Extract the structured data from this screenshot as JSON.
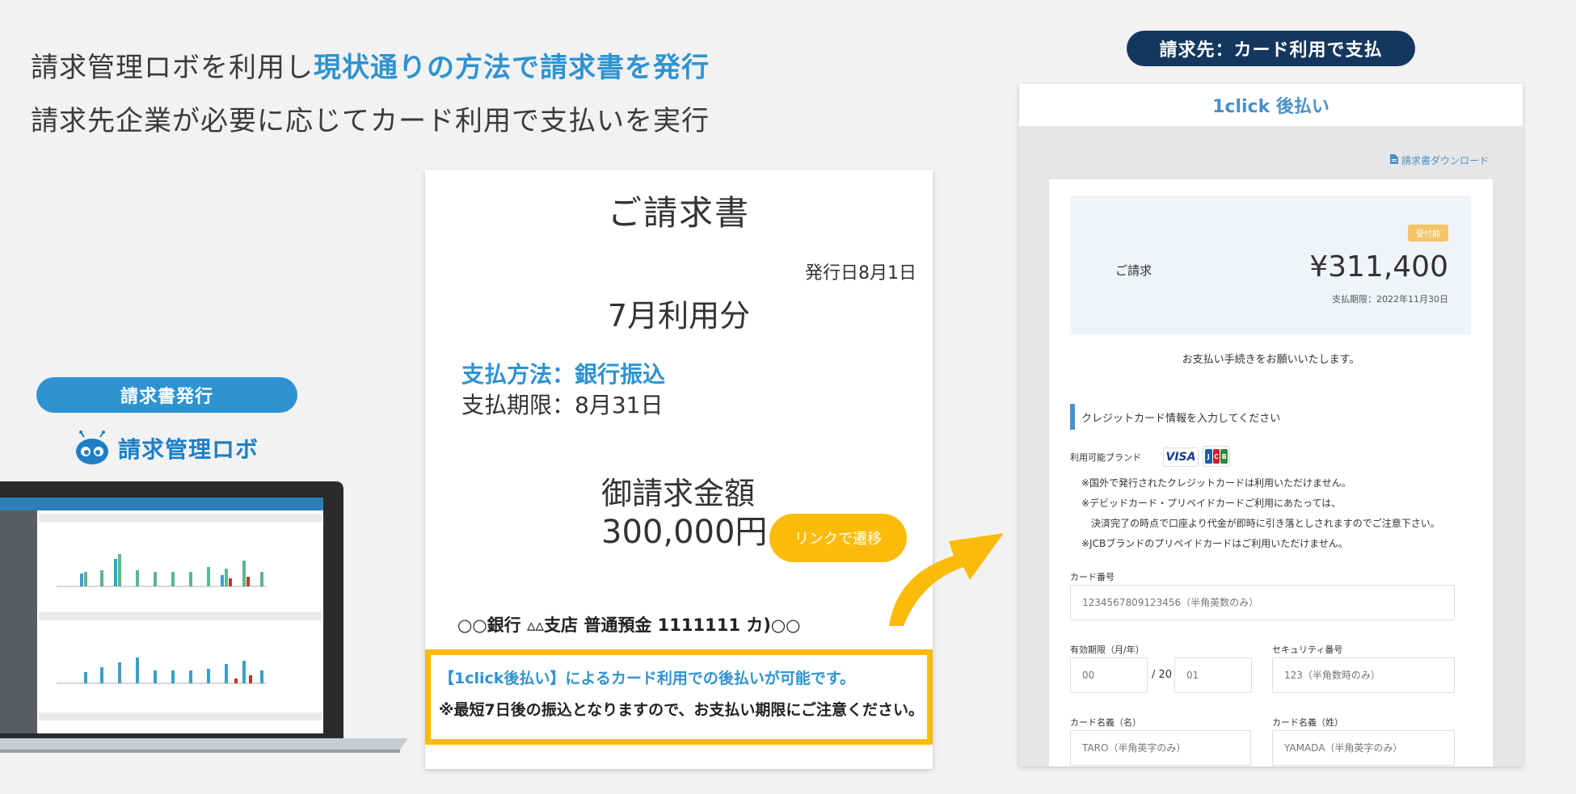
{
  "headline": {
    "line1_prefix": "請求管理ロボを利用し",
    "line1_highlight": "現状通りの方法で請求書を発行",
    "line2": "請求先企業が必要に応じてカード利用で支払いを実行"
  },
  "left": {
    "pill_label": "請求書発行",
    "logo_text": "請求管理ロボ"
  },
  "invoice": {
    "title": "ご請求書",
    "issue_date": "発行日8月1日",
    "usage_month": "7月利用分",
    "payment_method": "支払方法：銀行振込",
    "payment_due": "支払期限：8月31日",
    "amount_label": "御請求金額",
    "amount": "300,000円",
    "link_button": "リンクで遷移",
    "bank_info": "○○銀行 ▵▵支店 普通預金 1111111 カ)○○",
    "notice_line1": "【1click後払い】によるカード利用での後払いが可能です。",
    "notice_line2": "※最短7日後の振込となりますので、お支払い期限にご注意ください。"
  },
  "right": {
    "pill_label": "請求先：カード利用で支払"
  },
  "payment_page": {
    "header_title": "1click 後払い",
    "download_link": "請求書ダウンロード",
    "status_badge": "受付前",
    "summary_label": "ご請求",
    "summary_amount": "¥311,400",
    "summary_due": "支払期限：2022年11月30日",
    "thanks_text": "お支払い手続きをお願いいたします。",
    "section_title": "クレジットカード情報を入力してください",
    "brands_label": "利用可能ブランド",
    "brand_visa": "VISA",
    "brand_jcb": [
      "J",
      "C",
      "B"
    ],
    "notes": [
      "※国外で発行されたクレジットカードは利用いただけません。",
      "※デビッドカード・プリペイドカードご利用にあたっては、",
      "　決済完了の時点で口座より代金が即時に引き落としされますのでご注意下さい。",
      "※JCBブランドのプリペイドカードはご利用いただけません。"
    ],
    "card_number_label": "カード番号",
    "card_number_placeholder": "1234567809123456（半角英数のみ）",
    "expiry_label": "有効期限（月/年）",
    "expiry_month": "00",
    "expiry_separator": "/ 20",
    "expiry_year": "01",
    "security_label": "セキュリティ番号",
    "security_placeholder": "123（半角数時のみ）",
    "first_name_label": "カード名義（名）",
    "first_name_placeholder": "TARO（半角英字のみ）",
    "last_name_label": "カード名義（姓）",
    "last_name_placeholder": "YAMADA（半角英字のみ）"
  },
  "colors": {
    "blue": "#2e93d1",
    "navy": "#15375e",
    "yellow": "#fbbb0b"
  }
}
